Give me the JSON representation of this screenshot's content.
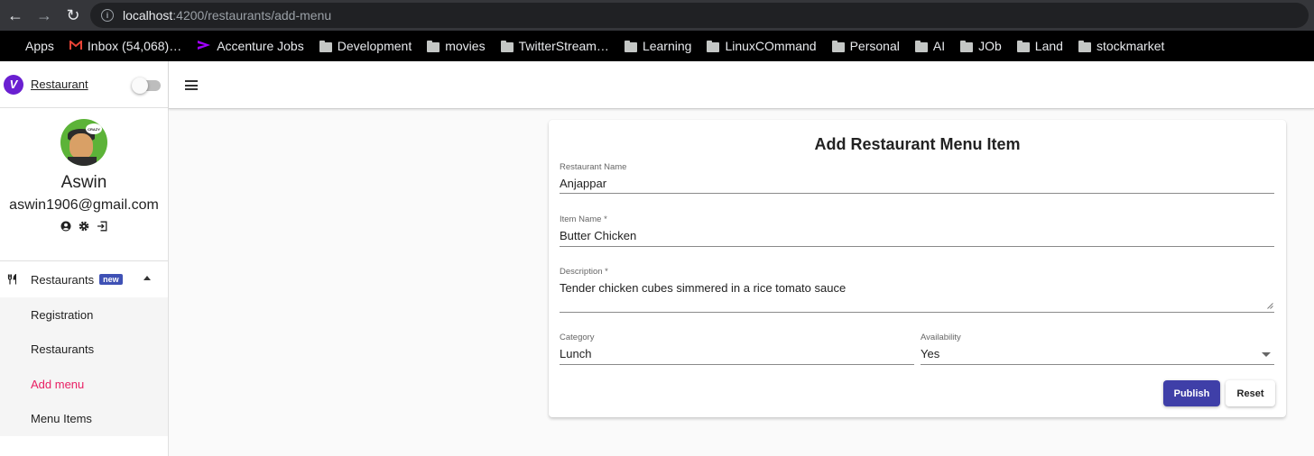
{
  "browser": {
    "url_host": "localhost",
    "url_path": ":4200/restaurants/add-menu",
    "bookmarks": [
      {
        "label": "Apps",
        "icon": "apps-grid-icon"
      },
      {
        "label": "Inbox (54,068)…",
        "icon": "gmail-icon"
      },
      {
        "label": "Accenture Jobs",
        "icon": "accenture-icon"
      },
      {
        "label": "Development",
        "icon": "folder-icon"
      },
      {
        "label": "movies",
        "icon": "folder-icon"
      },
      {
        "label": "TwitterStream…",
        "icon": "folder-icon"
      },
      {
        "label": "Learning",
        "icon": "folder-icon"
      },
      {
        "label": "LinuxCOmmand",
        "icon": "folder-icon"
      },
      {
        "label": "Personal",
        "icon": "folder-icon"
      },
      {
        "label": "AI",
        "icon": "folder-icon"
      },
      {
        "label": "JOb",
        "icon": "folder-icon"
      },
      {
        "label": "Land",
        "icon": "folder-icon"
      },
      {
        "label": "stockmarket",
        "icon": "folder-icon"
      }
    ]
  },
  "sidebar": {
    "brand": "Restaurant",
    "profile": {
      "avatar_bubble": "CRAZY",
      "name": "Aswin",
      "email": "aswin1906@gmail.com"
    },
    "group": {
      "label": "Restaurants",
      "badge": "new"
    },
    "items": [
      {
        "label": "Registration"
      },
      {
        "label": "Restaurants"
      },
      {
        "label": "Add menu"
      },
      {
        "label": "Menu Items"
      }
    ]
  },
  "form": {
    "title": "Add Restaurant Menu Item",
    "restaurant_name": {
      "label": "Restaurant Name",
      "value": "Anjappar"
    },
    "item_name": {
      "label": "Item Name *",
      "value": "Butter Chicken"
    },
    "description": {
      "label": "Description *",
      "value": "Tender chicken cubes simmered in a rice tomato sauce"
    },
    "category": {
      "label": "Category",
      "value": "Lunch"
    },
    "availability": {
      "label": "Availability",
      "value": "Yes"
    },
    "publish_label": "Publish",
    "reset_label": "Reset"
  },
  "colors": {
    "brand": "#6a1fd1",
    "primary_button": "#3f3fa8",
    "active_nav": "#e91e63",
    "badge": "#3f51b5"
  }
}
